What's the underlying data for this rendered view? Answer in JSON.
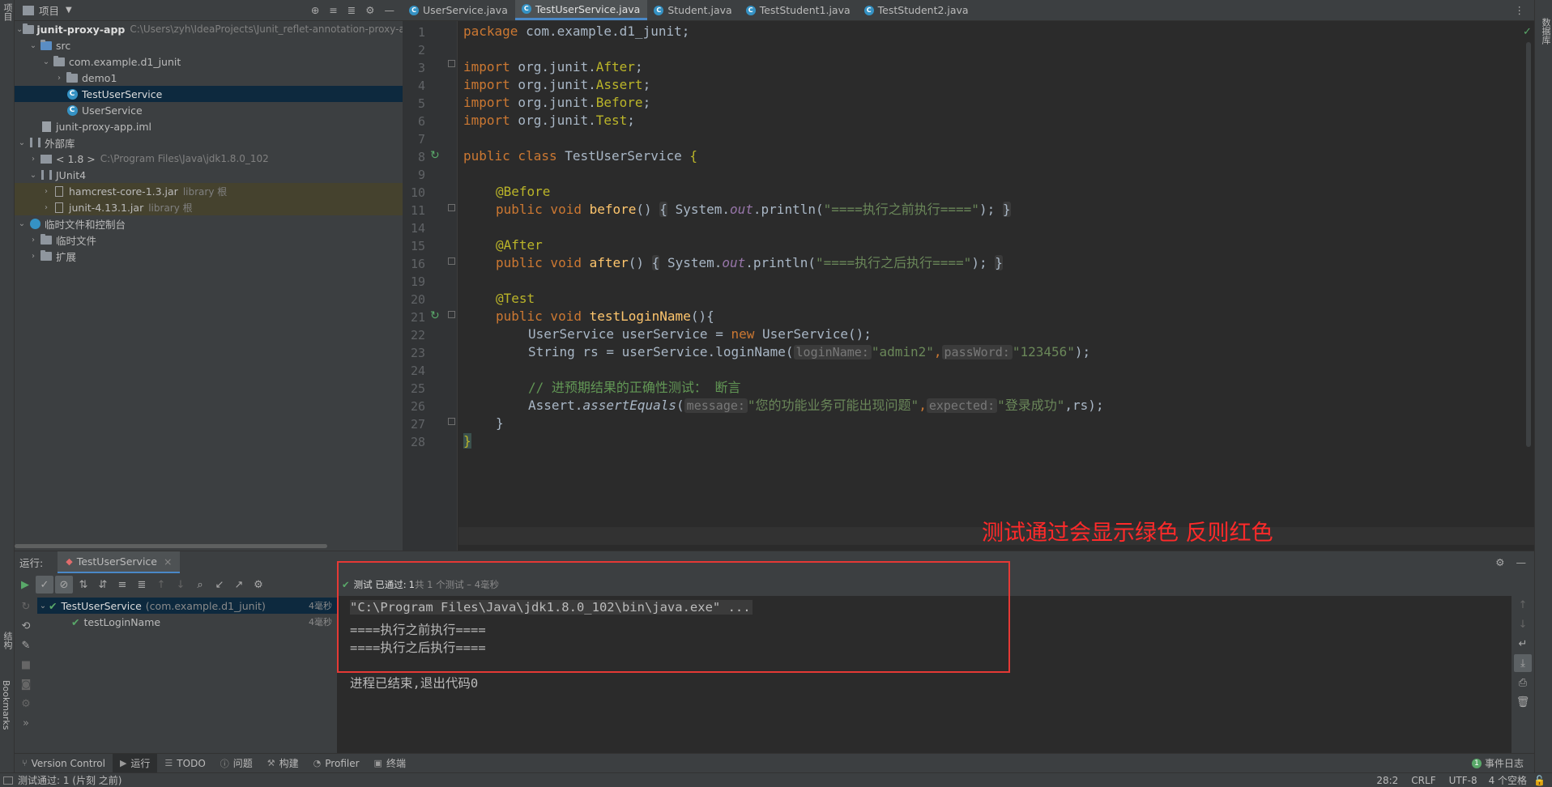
{
  "sidebar": {
    "project_label": "项目",
    "bookmarks_label": "Bookmarks",
    "structure_label": "结构",
    "right_label": "数据库"
  },
  "project": {
    "header_title": "项目",
    "tree": [
      {
        "label": "junit-proxy-app",
        "path": "C:\\Users\\zyh\\IdeaProjects\\Junit_reflet-annotation-proxy-a"
      },
      {
        "label": "src"
      },
      {
        "label": "com.example.d1_junit"
      },
      {
        "label": "demo1"
      },
      {
        "label": "TestUserService"
      },
      {
        "label": "UserService"
      },
      {
        "label": "junit-proxy-app.iml"
      },
      {
        "label": "外部库"
      },
      {
        "label": "< 1.8 >",
        "path": "C:\\Program Files\\Java\\jdk1.8.0_102"
      },
      {
        "label": "JUnit4"
      },
      {
        "label": "hamcrest-core-1.3.jar",
        "suffix": "library 根"
      },
      {
        "label": "junit-4.13.1.jar",
        "suffix": "library 根"
      },
      {
        "label": "临时文件和控制台"
      },
      {
        "label": "临时文件"
      },
      {
        "label": "扩展"
      }
    ]
  },
  "tabs": [
    "UserService.java",
    "TestUserService.java",
    "Student.java",
    "TestStudent1.java",
    "TestStudent2.java"
  ],
  "editor": {
    "line_numbers": [
      "1",
      "2",
      "3",
      "4",
      "5",
      "6",
      "7",
      "8",
      "9",
      "10",
      "11",
      "14",
      "15",
      "16",
      "19",
      "20",
      "21",
      "22",
      "23",
      "24",
      "25",
      "26",
      "27",
      "28"
    ],
    "code": {
      "l1_pkg": "package",
      "l1_rest": " com.example.d1_junit;",
      "imp": "import",
      "l3_pre": " org.junit.",
      "l3_cls": "After",
      "l4_pre": " org.junit.",
      "l4_cls": "Assert",
      "l5_pre": " org.junit.",
      "l5_cls": "Before",
      "l6_pre": " org.junit.",
      "l6_cls": "Test",
      "l8_kw": "public class ",
      "l8_name": "TestUserService ",
      "l8_brace": "{",
      "ann_before": "@Before",
      "pub_void": "public void ",
      "m_before": "before",
      "parens": "()",
      "lbrace": "{",
      "rbrace": "}",
      "sys": " System.",
      "out": "out",
      "println": ".println(",
      "s_before": "\"====执行之前执行====\"",
      "s_after": "\"====执行之后执行====\"",
      "semi_close": ");",
      "ann_after": "@After",
      "m_after": "after",
      "ann_test": "@Test",
      "m_test": "testLoginName",
      "l21_tail": "(){",
      "l22_a": "UserService userService = ",
      "l22_new": "new",
      "l22_b": " UserService();",
      "l23_a": "String rs = userService.loginName(",
      "hint_login": "loginName:",
      "s_admin": "\"admin2\"",
      "comma": ",",
      "hint_pass": "passWord:",
      "s_pwd": "\"123456\"",
      "l23_end": ");",
      "l25_comment": "// 进预期结果的正确性测试： 断言",
      "l26_a": "Assert.",
      "l26_m": "assertEquals",
      "l26_open": "(",
      "hint_msg": "message:",
      "s_msg": "\"您的功能业务可能出现问题\"",
      "hint_exp": "expected:",
      "s_exp": "\"登录成功\"",
      "l26_end": ",rs);",
      "l27": "}",
      "l28": "}"
    },
    "annotation_note": "测试通过会显示绿色 反则红色"
  },
  "run": {
    "label": "运行:",
    "tab": "TestUserService",
    "status_prefix": "测试 已通过:",
    "status_count": "1",
    "status_rest": "共 1 个测试 – 4毫秒",
    "tree": [
      {
        "name": "TestUserService",
        "pkg": "(com.example.d1_junit)",
        "time": "4毫秒"
      },
      {
        "name": "testLoginName",
        "time": "4毫秒"
      }
    ],
    "console": [
      "\"C:\\Program Files\\Java\\jdk1.8.0_102\\bin\\java.exe\" ...",
      "====执行之前执行====",
      "====执行之后执行====",
      "进程已结束,退出代码0"
    ]
  },
  "bottom_tools": [
    "Version Control",
    "运行",
    "TODO",
    "问题",
    "构建",
    "Profiler",
    "终端"
  ],
  "event_log": "事件日志",
  "status": {
    "message": "测试通过: 1 (片刻 之前)",
    "position": "28:2",
    "line_sep": "CRLF",
    "encoding": "UTF-8",
    "indent": "4 个空格"
  },
  "colors": {
    "accent": "#4a88c7",
    "pass": "#59a869",
    "note": "#ff2a2a"
  }
}
